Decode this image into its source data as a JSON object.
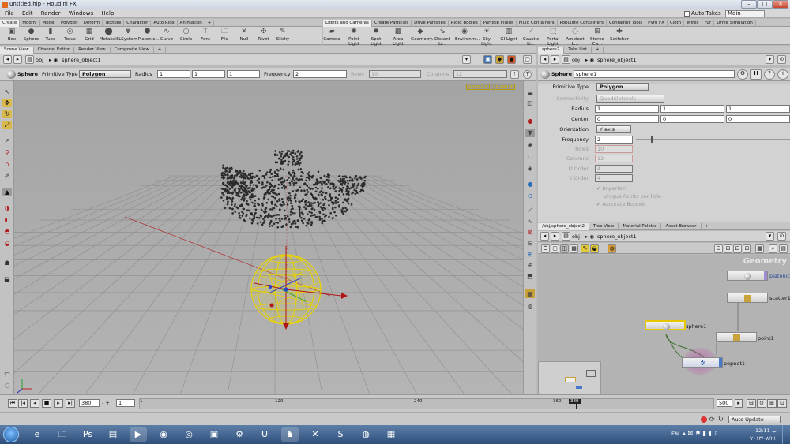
{
  "window": {
    "title": "untitled.hip - Houdini FX",
    "minimize": "–",
    "maximize": "□",
    "close": "✕"
  },
  "menu": [
    "File",
    "Edit",
    "Render",
    "Windows",
    "Help"
  ],
  "auto_takes": "Auto Takes",
  "desktop": "Main",
  "shelf_tabs_left": [
    "Create",
    "Modify",
    "Model",
    "Polygon",
    "Deform",
    "Texture",
    "Character",
    "Auto Rigs",
    "Animation"
  ],
  "shelf_tabs_right": [
    "Lights and Cameras",
    "Create Particles",
    "Drive Particles",
    "Rigid Bodies",
    "Particle Fluids",
    "Fluid Containers",
    "Populate Containers",
    "Container Tools",
    "Pyro FX",
    "Cloth",
    "Wires",
    "Fur",
    "Drive Simulation"
  ],
  "shelf_tools_left": [
    {
      "label": "Box",
      "icon": "▣"
    },
    {
      "label": "Sphere",
      "icon": "●"
    },
    {
      "label": "Tube",
      "icon": "▮"
    },
    {
      "label": "Torus",
      "icon": "◎"
    },
    {
      "label": "Grid",
      "icon": "▦"
    },
    {
      "label": "Metaball",
      "icon": "⬤"
    },
    {
      "label": "LSystem",
      "icon": "✾"
    },
    {
      "label": "Platonic...",
      "icon": "⬢"
    },
    {
      "label": "Curve",
      "icon": "∿"
    },
    {
      "label": "Circle",
      "icon": "○"
    },
    {
      "label": "Font",
      "icon": "T"
    },
    {
      "label": "File",
      "icon": "🗀"
    },
    {
      "label": "Null",
      "icon": "✕"
    },
    {
      "label": "Rivet",
      "icon": "✣"
    },
    {
      "label": "Sticky",
      "icon": "✎"
    }
  ],
  "shelf_tools_right": [
    {
      "label": "Camera",
      "icon": "▰"
    },
    {
      "label": "Point Light",
      "icon": "✺"
    },
    {
      "label": "Spot Light",
      "icon": "✹"
    },
    {
      "label": "Area Light",
      "icon": "▩"
    },
    {
      "label": "Geometry...",
      "icon": "◆"
    },
    {
      "label": "Distant Li...",
      "icon": "⇘"
    },
    {
      "label": "Environm...",
      "icon": "◉"
    },
    {
      "label": "Sky Light",
      "icon": "☀"
    },
    {
      "label": "GI Light",
      "icon": "▥"
    },
    {
      "label": "Caustic Li...",
      "icon": "⟋"
    },
    {
      "label": "Portal Light",
      "icon": "⬚"
    },
    {
      "label": "Ambient L...",
      "icon": "◌"
    },
    {
      "label": "Stereo Ca...",
      "icon": "⊞"
    },
    {
      "label": "Switcher",
      "icon": "✚"
    }
  ],
  "left_tabs": [
    "Scene View",
    "Channel Editor",
    "Render View",
    "Composite View"
  ],
  "right_tabs_top": [
    "sphere2",
    "Take List"
  ],
  "right_tabs_bottom": [
    "/obj/sphere_object2",
    "Tree View",
    "Material Palette",
    "Asset Browser"
  ],
  "left_path": {
    "level": "obj",
    "node": "sphere_object1"
  },
  "parm_path": {
    "level": "obj",
    "node": "sphere_object1"
  },
  "net_path": {
    "level": "obj",
    "node": "sphere_object1"
  },
  "opbar": {
    "node_type": "Sphere",
    "primitive_type_label": "Primitive Type",
    "primitive_type_value": "Polygon",
    "radius_label": "Radius",
    "radius": [
      "1",
      "1",
      "1"
    ],
    "frequency_label": "Frequency",
    "frequency": "2",
    "rows_label": "Rows",
    "rows": "10",
    "columns_label": "Columns",
    "columns": "12"
  },
  "viewport": {
    "tag_camera": "persp1 ▾",
    "tag_cam2": "no cam ▾"
  },
  "parms": {
    "node_type": "Sphere",
    "node_name": "sphere1",
    "primitive_type_label": "Primitive Type",
    "primitive_type": "Polygon",
    "connectivity_label": "Connectivity",
    "connectivity": "Quadrilaterals",
    "radius_label": "Radius",
    "radius": [
      "1",
      "1",
      "1"
    ],
    "center_label": "Center",
    "center": [
      "0",
      "0",
      "0"
    ],
    "orientation_label": "Orientation",
    "orientation": "Y axis",
    "frequency_label": "Frequency",
    "frequency": "2",
    "rows_label": "Rows",
    "rows": "10",
    "columns_label": "Columns",
    "columns": "12",
    "uorder_label": "U Order",
    "uorder": "4",
    "vorder_label": "V Order",
    "vorder": "4",
    "imperfect": "Imperfect",
    "unique_points": "Unique Points per Pole",
    "accurate_bounds": "Accurate Bounds"
  },
  "network": {
    "context_label": "Geometry",
    "nodes": [
      {
        "name": "platonic1"
      },
      {
        "name": "scatter1"
      },
      {
        "name": "sphere1"
      },
      {
        "name": "point1"
      },
      {
        "name": "popnet1"
      }
    ]
  },
  "timeline": {
    "current_frame": "380",
    "start_frame": "1",
    "end_frame": "500",
    "ticks": [
      "1",
      "120",
      "240",
      "360"
    ],
    "marker": "380",
    "progress": 0.76
  },
  "bottom": {
    "auto_update": "Auto Update"
  },
  "taskbar": {
    "apps": [
      "e",
      "🗀",
      "Ps",
      "▤",
      "▶",
      "◉",
      "◎",
      "▣",
      "⚙",
      "U",
      "♞",
      "✕",
      "S",
      "◍",
      "▦"
    ],
    "lang": "EN",
    "time": "12:11 ب",
    "date": "۲۰۱۳/۰۸/۲۱"
  }
}
